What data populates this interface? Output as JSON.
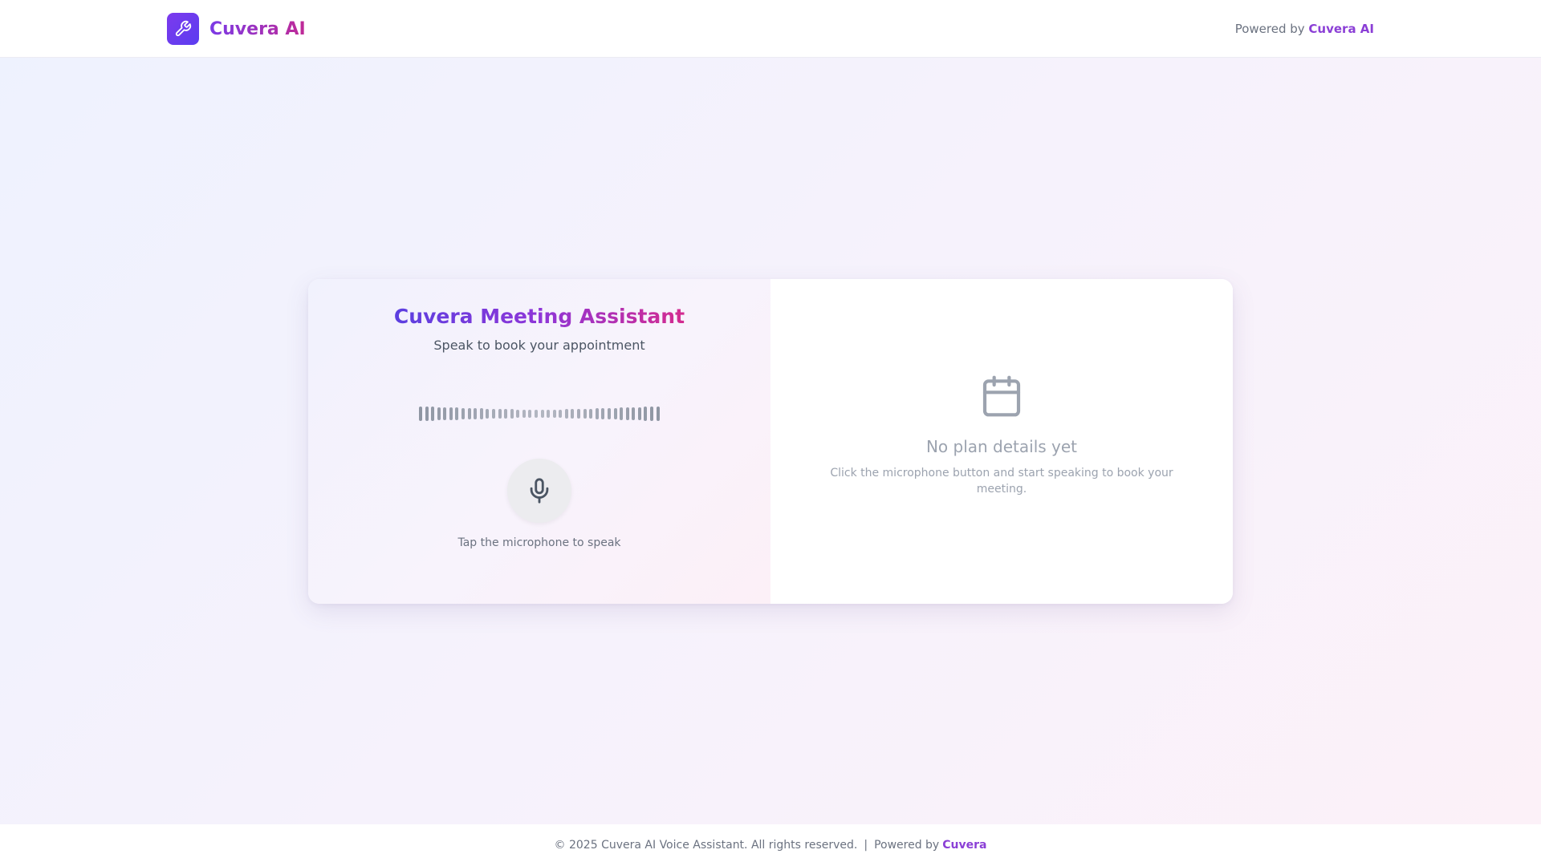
{
  "header": {
    "brand_name": "Cuvera AI",
    "logo_icon": "wrench-icon",
    "powered_prefix": "Powered by",
    "powered_brand": "Cuvera AI"
  },
  "assistant": {
    "title": "Cuvera Meeting Assistant",
    "subtitle": "Speak to book your appointment",
    "mic_icon": "microphone-icon",
    "hint": "Tap the microphone to speak"
  },
  "plan": {
    "icon": "calendar-icon",
    "empty_title": "No plan details yet",
    "empty_description": "Click the microphone button and start speaking to book your meeting."
  },
  "footer": {
    "copyright": "© 2025 Cuvera AI Voice Assistant. All rights reserved.",
    "separator": "|",
    "powered_prefix": "Powered by",
    "powered_brand": "Cuvera"
  },
  "colors": {
    "accent_purple": "#8b3fd6",
    "accent_pink": "#d42b8f",
    "logo_violet": "#7c3aed"
  }
}
